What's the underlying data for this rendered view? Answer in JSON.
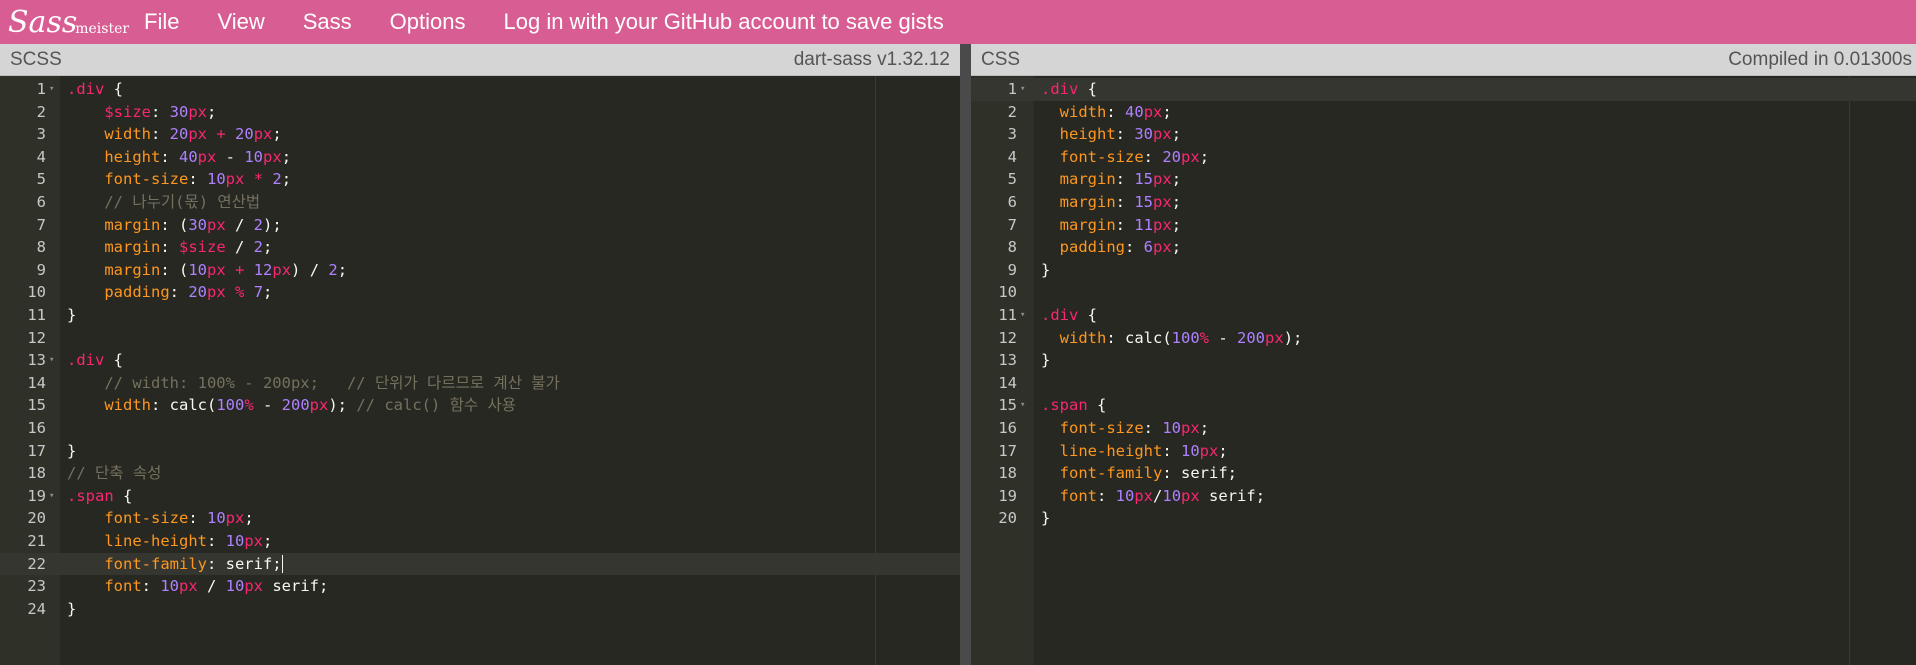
{
  "logo": {
    "script": "Sass",
    "word": "meister"
  },
  "menu": [
    "File",
    "View",
    "Sass",
    "Options",
    "Log in with your GitHub account to save gists"
  ],
  "left_pane": {
    "label": "SCSS",
    "info": "dart-sass v1.32.12"
  },
  "right_pane": {
    "label": "CSS",
    "info": "Compiled in 0.01300s"
  },
  "scss_lines": [
    {
      "n": "1",
      "fold": true,
      "t": [
        [
          "sel",
          ".div"
        ],
        [
          "plain",
          " {"
        ]
      ]
    },
    {
      "n": "2",
      "t": [
        [
          "plain",
          "    "
        ],
        [
          "var",
          "$size"
        ],
        [
          "plain",
          ": "
        ],
        [
          "num",
          "30"
        ],
        [
          "unit",
          "px"
        ],
        [
          "plain",
          ";"
        ]
      ]
    },
    {
      "n": "3",
      "t": [
        [
          "plain",
          "    "
        ],
        [
          "prop",
          "width"
        ],
        [
          "plain",
          ": "
        ],
        [
          "num",
          "20"
        ],
        [
          "unit",
          "px"
        ],
        [
          "plain",
          " "
        ],
        [
          "op",
          "+"
        ],
        [
          "plain",
          " "
        ],
        [
          "num",
          "20"
        ],
        [
          "unit",
          "px"
        ],
        [
          "plain",
          ";"
        ]
      ]
    },
    {
      "n": "4",
      "t": [
        [
          "plain",
          "    "
        ],
        [
          "prop",
          "height"
        ],
        [
          "plain",
          ": "
        ],
        [
          "num",
          "40"
        ],
        [
          "unit",
          "px"
        ],
        [
          "plain",
          " - "
        ],
        [
          "num",
          "10"
        ],
        [
          "unit",
          "px"
        ],
        [
          "plain",
          ";"
        ]
      ]
    },
    {
      "n": "5",
      "t": [
        [
          "plain",
          "    "
        ],
        [
          "prop",
          "font-size"
        ],
        [
          "plain",
          ": "
        ],
        [
          "num",
          "10"
        ],
        [
          "unit",
          "px"
        ],
        [
          "plain",
          " "
        ],
        [
          "op",
          "*"
        ],
        [
          "plain",
          " "
        ],
        [
          "num",
          "2"
        ],
        [
          "plain",
          ";"
        ]
      ]
    },
    {
      "n": "6",
      "t": [
        [
          "plain",
          "    "
        ],
        [
          "comment",
          "// 나누기(몫) 연산법"
        ]
      ]
    },
    {
      "n": "7",
      "t": [
        [
          "plain",
          "    "
        ],
        [
          "prop",
          "margin"
        ],
        [
          "plain",
          ": ("
        ],
        [
          "num",
          "30"
        ],
        [
          "unit",
          "px"
        ],
        [
          "plain",
          " / "
        ],
        [
          "num",
          "2"
        ],
        [
          "plain",
          ");"
        ]
      ]
    },
    {
      "n": "8",
      "t": [
        [
          "plain",
          "    "
        ],
        [
          "prop",
          "margin"
        ],
        [
          "plain",
          ": "
        ],
        [
          "var",
          "$size"
        ],
        [
          "plain",
          " / "
        ],
        [
          "num",
          "2"
        ],
        [
          "plain",
          ";"
        ]
      ]
    },
    {
      "n": "9",
      "t": [
        [
          "plain",
          "    "
        ],
        [
          "prop",
          "margin"
        ],
        [
          "plain",
          ": ("
        ],
        [
          "num",
          "10"
        ],
        [
          "unit",
          "px"
        ],
        [
          "plain",
          " "
        ],
        [
          "op",
          "+"
        ],
        [
          "plain",
          " "
        ],
        [
          "num",
          "12"
        ],
        [
          "unit",
          "px"
        ],
        [
          "plain",
          ") / "
        ],
        [
          "num",
          "2"
        ],
        [
          "plain",
          ";"
        ]
      ]
    },
    {
      "n": "10",
      "t": [
        [
          "plain",
          "    "
        ],
        [
          "prop",
          "padding"
        ],
        [
          "plain",
          ": "
        ],
        [
          "num",
          "20"
        ],
        [
          "unit",
          "px"
        ],
        [
          "plain",
          " "
        ],
        [
          "op",
          "%"
        ],
        [
          "plain",
          " "
        ],
        [
          "num",
          "7"
        ],
        [
          "plain",
          ";"
        ]
      ]
    },
    {
      "n": "11",
      "t": [
        [
          "plain",
          "}"
        ]
      ]
    },
    {
      "n": "12",
      "t": []
    },
    {
      "n": "13",
      "fold": true,
      "t": [
        [
          "sel",
          ".div"
        ],
        [
          "plain",
          " {"
        ]
      ]
    },
    {
      "n": "14",
      "t": [
        [
          "plain",
          "    "
        ],
        [
          "comment",
          "// width: 100% - 200px;   // 단위가 다르므로 계산 불가"
        ]
      ]
    },
    {
      "n": "15",
      "t": [
        [
          "plain",
          "    "
        ],
        [
          "prop",
          "width"
        ],
        [
          "plain",
          ": calc("
        ],
        [
          "num",
          "100"
        ],
        [
          "unit",
          "%"
        ],
        [
          "plain",
          " - "
        ],
        [
          "num",
          "200"
        ],
        [
          "unit",
          "px"
        ],
        [
          "plain",
          "); "
        ],
        [
          "comment",
          "// calc() 함수 사용"
        ]
      ]
    },
    {
      "n": "16",
      "t": []
    },
    {
      "n": "17",
      "t": [
        [
          "plain",
          "}"
        ]
      ]
    },
    {
      "n": "18",
      "t": [
        [
          "comment",
          "// 단축 속성"
        ]
      ]
    },
    {
      "n": "19",
      "fold": true,
      "t": [
        [
          "sel",
          ".span"
        ],
        [
          "plain",
          " {"
        ]
      ]
    },
    {
      "n": "20",
      "t": [
        [
          "plain",
          "    "
        ],
        [
          "prop",
          "font-size"
        ],
        [
          "plain",
          ": "
        ],
        [
          "num",
          "10"
        ],
        [
          "unit",
          "px"
        ],
        [
          "plain",
          ";"
        ]
      ]
    },
    {
      "n": "21",
      "t": [
        [
          "plain",
          "    "
        ],
        [
          "prop",
          "line-height"
        ],
        [
          "plain",
          ": "
        ],
        [
          "num",
          "10"
        ],
        [
          "unit",
          "px"
        ],
        [
          "plain",
          ";"
        ]
      ]
    },
    {
      "n": "22",
      "active": true,
      "cursor": true,
      "t": [
        [
          "plain",
          "    "
        ],
        [
          "prop",
          "font-family"
        ],
        [
          "plain",
          ": serif;"
        ]
      ]
    },
    {
      "n": "23",
      "t": [
        [
          "plain",
          "    "
        ],
        [
          "prop",
          "font"
        ],
        [
          "plain",
          ": "
        ],
        [
          "num",
          "10"
        ],
        [
          "unit",
          "px"
        ],
        [
          "plain",
          " / "
        ],
        [
          "num",
          "10"
        ],
        [
          "unit",
          "px"
        ],
        [
          "plain",
          " serif;"
        ]
      ]
    },
    {
      "n": "24",
      "t": [
        [
          "plain",
          "}"
        ]
      ]
    }
  ],
  "css_lines": [
    {
      "n": "1",
      "fold": true,
      "active": true,
      "t": [
        [
          "sel",
          ".div"
        ],
        [
          "plain",
          " {"
        ]
      ]
    },
    {
      "n": "2",
      "t": [
        [
          "plain",
          "  "
        ],
        [
          "prop",
          "width"
        ],
        [
          "plain",
          ": "
        ],
        [
          "num",
          "40"
        ],
        [
          "unit",
          "px"
        ],
        [
          "plain",
          ";"
        ]
      ]
    },
    {
      "n": "3",
      "t": [
        [
          "plain",
          "  "
        ],
        [
          "prop",
          "height"
        ],
        [
          "plain",
          ": "
        ],
        [
          "num",
          "30"
        ],
        [
          "unit",
          "px"
        ],
        [
          "plain",
          ";"
        ]
      ]
    },
    {
      "n": "4",
      "t": [
        [
          "plain",
          "  "
        ],
        [
          "prop",
          "font-size"
        ],
        [
          "plain",
          ": "
        ],
        [
          "num",
          "20"
        ],
        [
          "unit",
          "px"
        ],
        [
          "plain",
          ";"
        ]
      ]
    },
    {
      "n": "5",
      "t": [
        [
          "plain",
          "  "
        ],
        [
          "prop",
          "margin"
        ],
        [
          "plain",
          ": "
        ],
        [
          "num",
          "15"
        ],
        [
          "unit",
          "px"
        ],
        [
          "plain",
          ";"
        ]
      ]
    },
    {
      "n": "6",
      "t": [
        [
          "plain",
          "  "
        ],
        [
          "prop",
          "margin"
        ],
        [
          "plain",
          ": "
        ],
        [
          "num",
          "15"
        ],
        [
          "unit",
          "px"
        ],
        [
          "plain",
          ";"
        ]
      ]
    },
    {
      "n": "7",
      "t": [
        [
          "plain",
          "  "
        ],
        [
          "prop",
          "margin"
        ],
        [
          "plain",
          ": "
        ],
        [
          "num",
          "11"
        ],
        [
          "unit",
          "px"
        ],
        [
          "plain",
          ";"
        ]
      ]
    },
    {
      "n": "8",
      "t": [
        [
          "plain",
          "  "
        ],
        [
          "prop",
          "padding"
        ],
        [
          "plain",
          ": "
        ],
        [
          "num",
          "6"
        ],
        [
          "unit",
          "px"
        ],
        [
          "plain",
          ";"
        ]
      ]
    },
    {
      "n": "9",
      "t": [
        [
          "plain",
          "}"
        ]
      ]
    },
    {
      "n": "10",
      "t": []
    },
    {
      "n": "11",
      "fold": true,
      "t": [
        [
          "sel",
          ".div"
        ],
        [
          "plain",
          " {"
        ]
      ]
    },
    {
      "n": "12",
      "t": [
        [
          "plain",
          "  "
        ],
        [
          "prop",
          "width"
        ],
        [
          "plain",
          ": calc("
        ],
        [
          "num",
          "100"
        ],
        [
          "unit",
          "%"
        ],
        [
          "plain",
          " - "
        ],
        [
          "num",
          "200"
        ],
        [
          "unit",
          "px"
        ],
        [
          "plain",
          ");"
        ]
      ]
    },
    {
      "n": "13",
      "t": [
        [
          "plain",
          "}"
        ]
      ]
    },
    {
      "n": "14",
      "t": []
    },
    {
      "n": "15",
      "fold": true,
      "t": [
        [
          "sel",
          ".span"
        ],
        [
          "plain",
          " {"
        ]
      ]
    },
    {
      "n": "16",
      "t": [
        [
          "plain",
          "  "
        ],
        [
          "prop",
          "font-size"
        ],
        [
          "plain",
          ": "
        ],
        [
          "num",
          "10"
        ],
        [
          "unit",
          "px"
        ],
        [
          "plain",
          ";"
        ]
      ]
    },
    {
      "n": "17",
      "t": [
        [
          "plain",
          "  "
        ],
        [
          "prop",
          "line-height"
        ],
        [
          "plain",
          ": "
        ],
        [
          "num",
          "10"
        ],
        [
          "unit",
          "px"
        ],
        [
          "plain",
          ";"
        ]
      ]
    },
    {
      "n": "18",
      "t": [
        [
          "plain",
          "  "
        ],
        [
          "prop",
          "font-family"
        ],
        [
          "plain",
          ": serif;"
        ]
      ]
    },
    {
      "n": "19",
      "t": [
        [
          "plain",
          "  "
        ],
        [
          "prop",
          "font"
        ],
        [
          "plain",
          ": "
        ],
        [
          "num",
          "10"
        ],
        [
          "unit",
          "px"
        ],
        [
          "plain",
          "/"
        ],
        [
          "num",
          "10"
        ],
        [
          "unit",
          "px"
        ],
        [
          "plain",
          " serif;"
        ]
      ]
    },
    {
      "n": "20",
      "t": [
        [
          "plain",
          "}"
        ]
      ]
    }
  ]
}
